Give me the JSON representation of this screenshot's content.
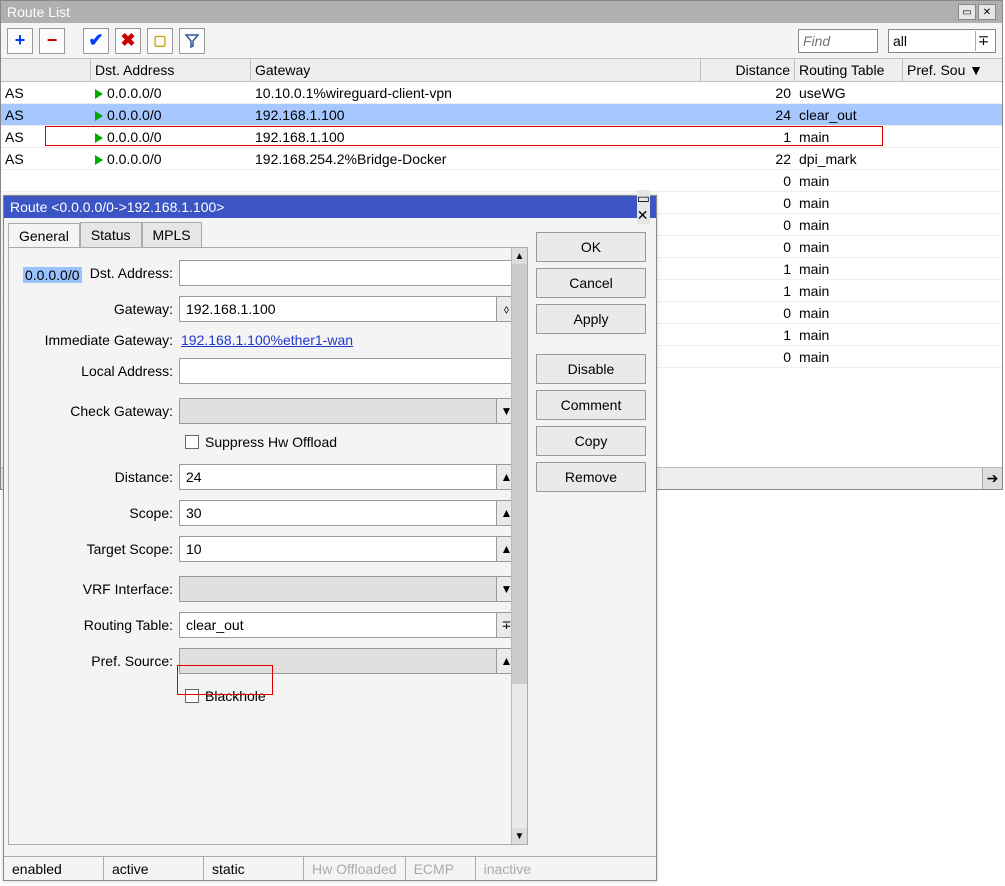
{
  "window": {
    "title": "Route List",
    "find_placeholder": "Find",
    "filter_value": "all"
  },
  "columns": {
    "c0": "",
    "c1": "Dst. Address",
    "c2": "Gateway",
    "c3": "Distance",
    "c4": "Routing Table",
    "c5": "Pref. Sou"
  },
  "rows": [
    {
      "flag": "AS",
      "dst": "0.0.0.0/0",
      "gw": "10.10.0.1%wireguard-client-vpn",
      "dist": "20",
      "tbl": "useWG",
      "tri": true
    },
    {
      "flag": "AS",
      "dst": "0.0.0.0/0",
      "gw": "192.168.1.100",
      "dist": "24",
      "tbl": "clear_out",
      "tri": true
    },
    {
      "flag": "AS",
      "dst": "0.0.0.0/0",
      "gw": "192.168.1.100",
      "dist": "1",
      "tbl": "main",
      "tri": true
    },
    {
      "flag": "AS",
      "dst": "0.0.0.0/0",
      "gw": "192.168.254.2%Bridge-Docker",
      "dist": "22",
      "tbl": "dpi_mark",
      "tri": true
    },
    {
      "flag": "",
      "dst": "",
      "gw": "",
      "dist": "0",
      "tbl": "main",
      "tri": false
    },
    {
      "flag": "",
      "dst": "",
      "gw": "",
      "dist": "0",
      "tbl": "main",
      "tri": false
    },
    {
      "flag": "",
      "dst": "",
      "gw": "",
      "dist": "0",
      "tbl": "main",
      "tri": false
    },
    {
      "flag": "",
      "dst": "",
      "gw": "",
      "dist": "0",
      "tbl": "main",
      "tri": false
    },
    {
      "flag": "",
      "dst": "",
      "gw": "",
      "dist": "1",
      "tbl": "main",
      "tri": false
    },
    {
      "flag": "",
      "dst": "",
      "gw": "",
      "dist": "1",
      "tbl": "main",
      "tri": false
    },
    {
      "flag": "",
      "dst": "",
      "gw": "",
      "dist": "0",
      "tbl": "main",
      "tri": false
    },
    {
      "flag": "",
      "dst": "",
      "gw": "",
      "dist": "1",
      "tbl": "main",
      "tri": false
    },
    {
      "flag": "",
      "dst": "",
      "gw": "",
      "dist": "0",
      "tbl": "main",
      "tri": false
    }
  ],
  "dialog": {
    "title": "Route <0.0.0.0/0->192.168.1.100>",
    "tabs": {
      "general": "General",
      "status": "Status",
      "mpls": "MPLS"
    },
    "labels": {
      "dst": "Dst. Address:",
      "gw": "Gateway:",
      "imm": "Immediate Gateway:",
      "local": "Local Address:",
      "chk": "Check Gateway:",
      "suppress": "Suppress Hw Offload",
      "dist": "Distance:",
      "scope": "Scope:",
      "tscope": "Target Scope:",
      "vrf": "VRF Interface:",
      "rtable": "Routing Table:",
      "psrc": "Pref. Source:",
      "blackhole": "Blackhole"
    },
    "values": {
      "dst": "0.0.0.0/0",
      "gw": "192.168.1.100",
      "imm": "192.168.1.100%ether1-wan",
      "local": "",
      "chk": "",
      "dist": "24",
      "scope": "30",
      "tscope": "10",
      "vrf": "",
      "rtable": "clear_out",
      "psrc": ""
    },
    "buttons": {
      "ok": "OK",
      "cancel": "Cancel",
      "apply": "Apply",
      "disable": "Disable",
      "comment": "Comment",
      "copy": "Copy",
      "remove": "Remove"
    },
    "status": {
      "enabled": "enabled",
      "active": "active",
      "static": "static",
      "hw": "Hw Offloaded",
      "ecmp": "ECMP",
      "inactive": "inactive"
    }
  }
}
